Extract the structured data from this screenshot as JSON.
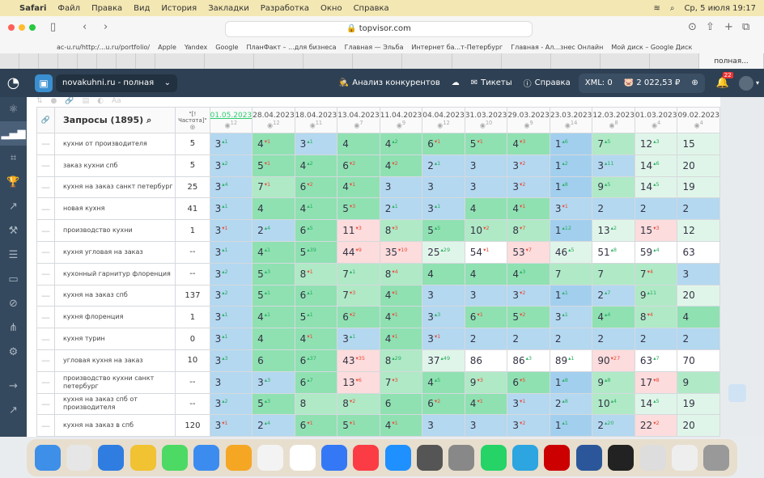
{
  "menubar": {
    "app": "Safari",
    "items": [
      "Файл",
      "Правка",
      "Вид",
      "История",
      "Закладки",
      "Разработка",
      "Окно",
      "Справка"
    ],
    "clock": "Ср, 5 июля  19:17"
  },
  "browser": {
    "url": "topvisor.com",
    "bookmarks": [
      "ac-u.ru/http:/...u.ru/portfolio/",
      "Apple",
      "Yandex",
      "Google",
      "ПланФакт – ...для бизнеса",
      "Главная — Эльба",
      "Интернет ба...т-Петербург",
      "Главная - Ал...знес Онлайн",
      "Мой диск – Google Диск"
    ],
    "active_tab": "полная..."
  },
  "header": {
    "project": "novakuhni.ru - полная",
    "competitors": "Анализ конкурентов",
    "tickets": "Тикеты",
    "help": "Справка",
    "xml": "XML: 0",
    "balance": "2 022,53 ₽",
    "notifications": "22"
  },
  "table": {
    "queries_header": "Запросы (1895)",
    "freq_header": "\"[!Частота]\"",
    "dates": [
      {
        "d": "01.05.2023",
        "n": "12"
      },
      {
        "d": "28.04.2023",
        "n": "12"
      },
      {
        "d": "18.04.2023",
        "n": "11"
      },
      {
        "d": "13.04.2023",
        "n": "7"
      },
      {
        "d": "11.04.2023",
        "n": "9"
      },
      {
        "d": "04.04.2023",
        "n": "12"
      },
      {
        "d": "31.03.2023",
        "n": "10"
      },
      {
        "d": "29.03.2023",
        "n": "9"
      },
      {
        "d": "23.03.2023",
        "n": "14"
      },
      {
        "d": "12.03.2023",
        "n": "8"
      },
      {
        "d": "01.03.2023",
        "n": "4"
      },
      {
        "d": "09.02.2023",
        "n": "4"
      }
    ],
    "rows": [
      {
        "q": "кухни от производителя",
        "f": "5",
        "p": [
          [
            3,
            1
          ],
          [
            4,
            -1
          ],
          [
            3,
            1
          ],
          [
            4,
            0
          ],
          [
            4,
            2
          ],
          [
            6,
            -1
          ],
          [
            5,
            -1
          ],
          [
            4,
            -3
          ],
          [
            1,
            6
          ],
          [
            7,
            5
          ],
          [
            12,
            3
          ],
          [
            15,
            0
          ]
        ]
      },
      {
        "q": "заказ кухни спб",
        "f": "5",
        "p": [
          [
            3,
            2
          ],
          [
            5,
            -1
          ],
          [
            4,
            2
          ],
          [
            6,
            -2
          ],
          [
            4,
            -2
          ],
          [
            2,
            1
          ],
          [
            3,
            0
          ],
          [
            3,
            -2
          ],
          [
            1,
            2
          ],
          [
            3,
            11
          ],
          [
            14,
            6
          ],
          [
            20,
            0
          ]
        ]
      },
      {
        "q": "кухня на заказ санкт петербург",
        "f": "25",
        "p": [
          [
            3,
            4
          ],
          [
            7,
            -1
          ],
          [
            6,
            -2
          ],
          [
            4,
            -1
          ],
          [
            3,
            0
          ],
          [
            3,
            0
          ],
          [
            3,
            0
          ],
          [
            3,
            -2
          ],
          [
            1,
            8
          ],
          [
            9,
            5
          ],
          [
            14,
            5
          ],
          [
            19,
            0
          ]
        ]
      },
      {
        "q": "новая кухня",
        "f": "41",
        "p": [
          [
            3,
            1
          ],
          [
            4,
            0
          ],
          [
            4,
            1
          ],
          [
            5,
            -3
          ],
          [
            2,
            1
          ],
          [
            3,
            1
          ],
          [
            4,
            0
          ],
          [
            4,
            -1
          ],
          [
            3,
            -1
          ],
          [
            2,
            0
          ],
          [
            2,
            0
          ],
          [
            2,
            0
          ]
        ]
      },
      {
        "q": "производство кухни",
        "f": "1",
        "p": [
          [
            3,
            -1
          ],
          [
            2,
            4
          ],
          [
            6,
            5
          ],
          [
            11,
            -3
          ],
          [
            8,
            -3
          ],
          [
            5,
            5
          ],
          [
            10,
            -2
          ],
          [
            8,
            -7
          ],
          [
            1,
            12
          ],
          [
            13,
            2
          ],
          [
            15,
            -3
          ],
          [
            12,
            0
          ]
        ]
      },
      {
        "q": "кухня угловая на заказ",
        "f": "--",
        "p": [
          [
            3,
            1
          ],
          [
            4,
            1
          ],
          [
            5,
            39
          ],
          [
            44,
            -9
          ],
          [
            35,
            -10
          ],
          [
            25,
            29
          ],
          [
            54,
            -1
          ],
          [
            53,
            -7
          ],
          [
            46,
            5
          ],
          [
            51,
            8
          ],
          [
            59,
            4
          ],
          [
            63,
            0
          ]
        ]
      },
      {
        "q": "кухонный гарнитур флоренция",
        "f": "--",
        "p": [
          [
            3,
            2
          ],
          [
            5,
            3
          ],
          [
            8,
            -1
          ],
          [
            7,
            1
          ],
          [
            8,
            -4
          ],
          [
            4,
            0
          ],
          [
            4,
            0
          ],
          [
            4,
            3
          ],
          [
            7,
            0
          ],
          [
            7,
            0
          ],
          [
            7,
            -4
          ],
          [
            3,
            0
          ]
        ]
      },
      {
        "q": "кухня на заказ спб",
        "f": "137",
        "p": [
          [
            3,
            2
          ],
          [
            5,
            1
          ],
          [
            6,
            1
          ],
          [
            7,
            -3
          ],
          [
            4,
            -1
          ],
          [
            3,
            0
          ],
          [
            3,
            0
          ],
          [
            3,
            -2
          ],
          [
            1,
            1
          ],
          [
            2,
            7
          ],
          [
            9,
            11
          ],
          [
            20,
            0
          ]
        ]
      },
      {
        "q": "кухня флоренция",
        "f": "1",
        "p": [
          [
            3,
            1
          ],
          [
            4,
            1
          ],
          [
            5,
            1
          ],
          [
            6,
            -2
          ],
          [
            4,
            -1
          ],
          [
            3,
            3
          ],
          [
            6,
            -1
          ],
          [
            5,
            -2
          ],
          [
            3,
            1
          ],
          [
            4,
            4
          ],
          [
            8,
            -4
          ],
          [
            4,
            0
          ]
        ]
      },
      {
        "q": "кухня турин",
        "f": "0",
        "p": [
          [
            3,
            1
          ],
          [
            4,
            0
          ],
          [
            4,
            -1
          ],
          [
            3,
            1
          ],
          [
            4,
            -1
          ],
          [
            3,
            -1
          ],
          [
            2,
            0
          ],
          [
            2,
            0
          ],
          [
            2,
            0
          ],
          [
            2,
            0
          ],
          [
            2,
            0
          ],
          [
            2,
            0
          ]
        ]
      },
      {
        "q": "угловая кухня на заказ",
        "f": "10",
        "p": [
          [
            3,
            3
          ],
          [
            6,
            0
          ],
          [
            6,
            37
          ],
          [
            43,
            -35
          ],
          [
            8,
            29
          ],
          [
            37,
            49
          ],
          [
            86,
            0
          ],
          [
            86,
            3
          ],
          [
            89,
            1
          ],
          [
            90,
            -27
          ],
          [
            63,
            7
          ],
          [
            70,
            0
          ]
        ]
      },
      {
        "q": "производство кухни санкт петербург",
        "f": "--",
        "p": [
          [
            3,
            0
          ],
          [
            3,
            3
          ],
          [
            6,
            7
          ],
          [
            13,
            -6
          ],
          [
            7,
            -3
          ],
          [
            4,
            5
          ],
          [
            9,
            -3
          ],
          [
            6,
            -5
          ],
          [
            1,
            8
          ],
          [
            9,
            8
          ],
          [
            17,
            -8
          ],
          [
            9,
            0
          ]
        ]
      },
      {
        "q": "кухня на заказ спб от производителя",
        "f": "--",
        "p": [
          [
            3,
            2
          ],
          [
            5,
            3
          ],
          [
            8,
            0
          ],
          [
            8,
            -2
          ],
          [
            6,
            0
          ],
          [
            6,
            -2
          ],
          [
            4,
            -1
          ],
          [
            3,
            -1
          ],
          [
            2,
            8
          ],
          [
            10,
            4
          ],
          [
            14,
            5
          ],
          [
            19,
            0
          ]
        ]
      },
      {
        "q": "кухня на заказ в спб",
        "f": "120",
        "p": [
          [
            3,
            -1
          ],
          [
            2,
            4
          ],
          [
            6,
            -1
          ],
          [
            5,
            -1
          ],
          [
            4,
            -1
          ],
          [
            3,
            0
          ],
          [
            3,
            0
          ],
          [
            3,
            -2
          ],
          [
            1,
            1
          ],
          [
            2,
            20
          ],
          [
            22,
            -2
          ],
          [
            20,
            0
          ]
        ]
      }
    ]
  },
  "colors": {
    "header_bg": "#2e4053",
    "sidebar_bg": "#34495e",
    "top1": "#a2cfee",
    "top3": "#b4d8f0",
    "top6": "#8fe1b2",
    "top10": "#afe9c6",
    "top50": "#e0f5e9",
    "worse": "#fcdcdc",
    "up": "#27ae60",
    "down": "#e74c3c"
  }
}
